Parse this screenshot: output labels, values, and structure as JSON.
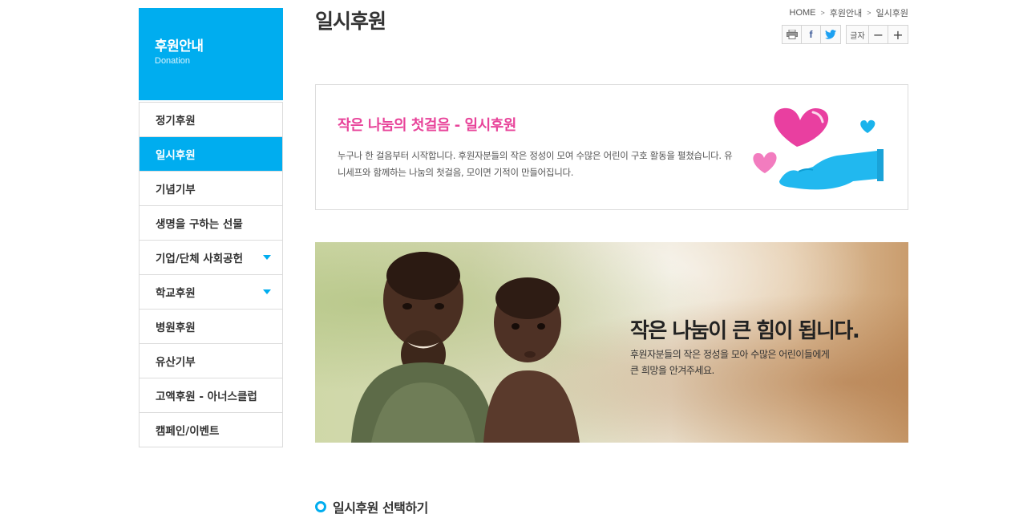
{
  "sidebar": {
    "title": "후원안내",
    "subtitle": "Donation",
    "items": [
      {
        "label": "정기후원"
      },
      {
        "label": "일시후원",
        "active": true
      },
      {
        "label": "기념기부"
      },
      {
        "label": "생명을 구하는 선물"
      },
      {
        "label": "기업/단체 사회공헌",
        "has_submenu": true
      },
      {
        "label": "학교후원",
        "has_submenu": true
      },
      {
        "label": "병원후원"
      },
      {
        "label": "유산기부"
      },
      {
        "label": "고액후원 - 아너스클럽"
      },
      {
        "label": "캠페인/이벤트"
      }
    ]
  },
  "header": {
    "page_title": "일시후원",
    "breadcrumb": [
      "HOME",
      "후원안내",
      "일시후원"
    ],
    "tools": {
      "print_icon": "printer-icon",
      "facebook_label": "f",
      "twitter_icon": "twitter-bird-icon",
      "text_size_label": "글자",
      "minus_label": "−",
      "plus_label": "+"
    }
  },
  "intro": {
    "heading": "작은 나눔의 첫걸음 - 일시후원",
    "body": "누구나 한 걸음부터 시작합니다. 후원자분들의 작은 정성이 모여 수많은 어린이 구호 활동을 펼쳤습니다. 유니세프와 함께하는 나눔의 첫걸음, 모이면 기적이 만들어집니다.",
    "art_icon": "hand-with-hearts-icon"
  },
  "banner": {
    "title": "작은 나눔이 큰 힘이 됩니다.",
    "sub_line1": "후원자분들의 작은 정성을 모아 수많은 어린이들에게",
    "sub_line2": "큰 희망을 안겨주세요."
  },
  "section": {
    "title": "일시후원 선택하기"
  },
  "colors": {
    "accent": "#00adef",
    "heading_pink": "#e8449a"
  }
}
